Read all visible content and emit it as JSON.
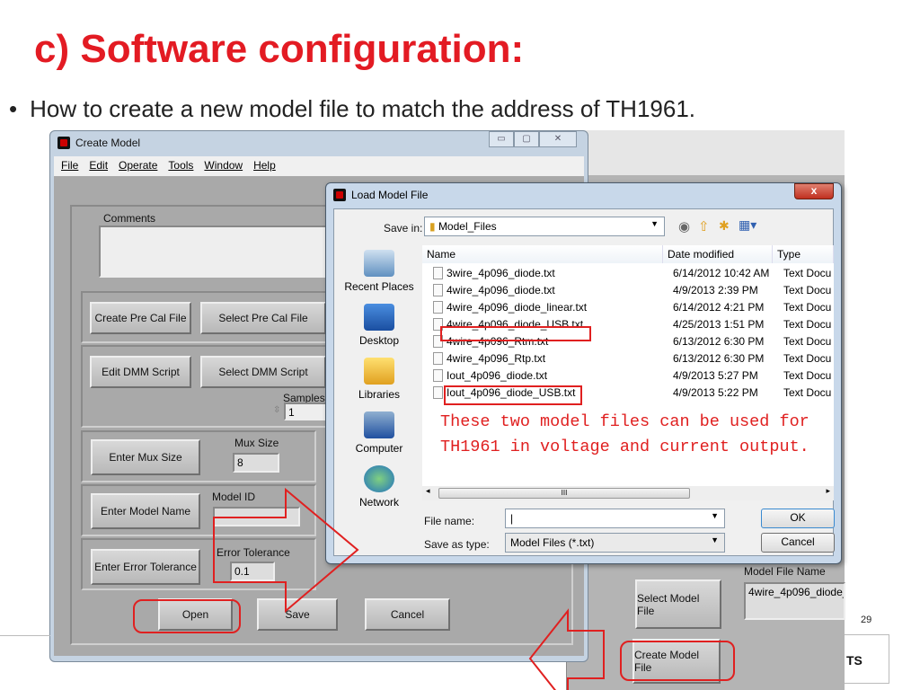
{
  "slide": {
    "title": "c) Software configuration:",
    "bullet": "How to create a new model file to match the address of TH1961.",
    "page_number": "29",
    "footer_text": "TS"
  },
  "create_model": {
    "title": "Create Model",
    "menu": [
      "File",
      "Edit",
      "Operate",
      "Tools",
      "Window",
      "Help"
    ],
    "comments_label": "Comments",
    "buttons": {
      "create_pre_cal": "Create Pre Cal File",
      "select_pre_cal": "Select Pre Cal File",
      "edit_dmm": "Edit DMM Script",
      "select_dmm": "Select DMM Script",
      "enter_mux": "Enter Mux Size",
      "enter_model_name": "Enter Model Name",
      "enter_error_tol": "Enter Error Tolerance",
      "open": "Open",
      "save": "Save",
      "cancel": "Cancel"
    },
    "samples_label": "Samples",
    "samples_value": "1",
    "mux_label": "Mux Size",
    "mux_value": "8",
    "model_id_label": "Model ID",
    "model_id_value": "",
    "error_tol_label": "Error Tolerance",
    "error_tol_value": "0.1"
  },
  "load_dialog": {
    "title": "Load Model File",
    "close": "x",
    "save_in_label": "Save in:",
    "save_in_value": "Model_Files",
    "places": [
      "Recent Places",
      "Desktop",
      "Libraries",
      "Computer",
      "Network"
    ],
    "columns": [
      "Name",
      "Date modified",
      "Type"
    ],
    "files": [
      {
        "name": "3wire_4p096_diode.txt",
        "date": "6/14/2012 10:42 AM",
        "type": "Text Docu"
      },
      {
        "name": "4wire_4p096_diode.txt",
        "date": "4/9/2013 2:39 PM",
        "type": "Text Docu"
      },
      {
        "name": "4wire_4p096_diode_linear.txt",
        "date": "6/14/2012 4:21 PM",
        "type": "Text Docu"
      },
      {
        "name": "4wire_4p096_diode_USB.txt",
        "date": "4/25/2013 1:51 PM",
        "type": "Text Docu"
      },
      {
        "name": "4wire_4p096_Rtm.txt",
        "date": "6/13/2012 6:30 PM",
        "type": "Text Docu"
      },
      {
        "name": "4wire_4p096_Rtp.txt",
        "date": "6/13/2012 6:30 PM",
        "type": "Text Docu"
      },
      {
        "name": "Iout_4p096_diode.txt",
        "date": "4/9/2013 5:27 PM",
        "type": "Text Docu"
      },
      {
        "name": "Iout_4p096_diode_USB.txt",
        "date": "4/9/2013 5:22 PM",
        "type": "Text Docu"
      }
    ],
    "note_line1": "These two model files can be used for",
    "note_line2": "TH1961 in voltage and current output.",
    "scroll_grip": "III",
    "file_name_label": "File name:",
    "file_name_value": "",
    "save_type_label": "Save as type:",
    "save_type_value": "Model Files (*.txt)",
    "ok": "OK",
    "cancel": "Cancel"
  },
  "back_app": {
    "model_file_name_label": "Model File Name",
    "model_file_name_value": "4wire_4p096_diode_",
    "select_model_file": "Select Model File",
    "create_model_file": "Create Model File"
  },
  "colors": {
    "title_red": "#e31b23",
    "annotation_red": "#e02020"
  }
}
